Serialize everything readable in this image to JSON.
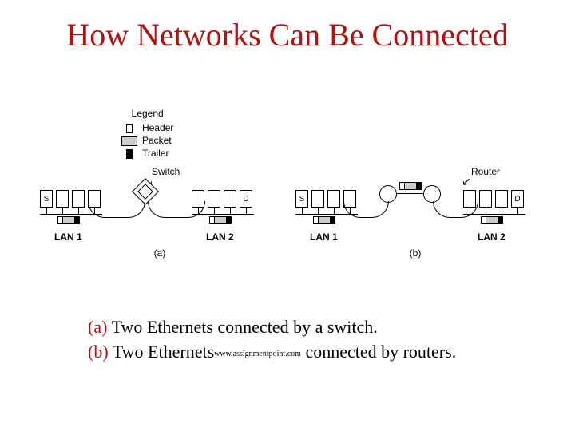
{
  "title": "How Networks Can Be Connected",
  "legend": {
    "title": "Legend",
    "header": "Header",
    "packet": "Packet",
    "trailer": "Trailer"
  },
  "diagrams": {
    "a": {
      "device_label": "Switch",
      "lan1": {
        "name": "LAN 1",
        "hosts": [
          "S",
          "",
          "",
          ""
        ]
      },
      "lan2": {
        "name": "LAN 2",
        "hosts": [
          "",
          "",
          "",
          "D"
        ]
      },
      "sub": "(a)"
    },
    "b": {
      "device_label": "Router",
      "lan1": {
        "name": "LAN 1",
        "hosts": [
          "S",
          "",
          "",
          ""
        ]
      },
      "lan2": {
        "name": "LAN 2",
        "hosts": [
          "",
          "",
          "",
          "D"
        ]
      },
      "sub": "(b)"
    }
  },
  "captions": {
    "a_prefix": "(a) ",
    "a_text": "Two Ethernets connected  by a switch.",
    "b_prefix": "(b) ",
    "b_text_1": "Two Ethernets",
    "b_wm": "www.assignmentpoint.com",
    "b_text_2": " connected by routers."
  },
  "chart_data": {
    "type": "diagram",
    "panels": [
      {
        "id": "a",
        "connector": "Switch",
        "lans": [
          {
            "name": "LAN 1",
            "hosts": 4,
            "labeled": {
              "0": "S"
            }
          },
          {
            "name": "LAN 2",
            "hosts": 4,
            "labeled": {
              "3": "D"
            }
          }
        ],
        "packet_visible_on": [
          "LAN 1",
          "LAN 2"
        ]
      },
      {
        "id": "b",
        "connector": "Router",
        "router_count": 2,
        "lans": [
          {
            "name": "LAN 1",
            "hosts": 4,
            "labeled": {
              "0": "S"
            }
          },
          {
            "name": "LAN 2",
            "hosts": 4,
            "labeled": {
              "3": "D"
            }
          }
        ],
        "packet_visible_on": [
          "LAN 1",
          "between-routers",
          "LAN 2"
        ]
      }
    ],
    "legend": [
      "Header",
      "Packet",
      "Trailer"
    ]
  }
}
